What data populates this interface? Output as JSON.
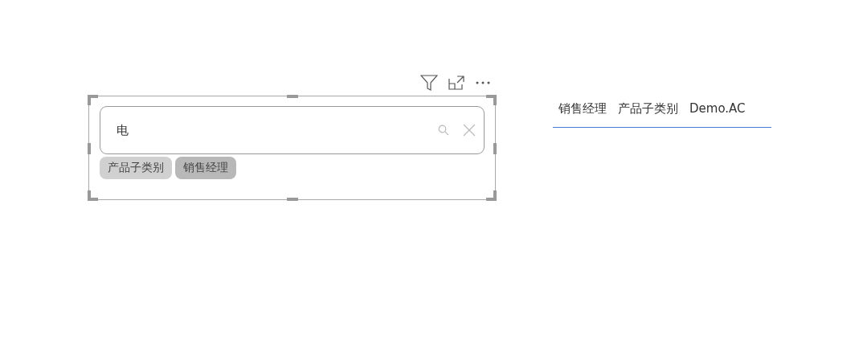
{
  "search": {
    "value": "电"
  },
  "chips": [
    {
      "label": "产品子类别",
      "selected": false
    },
    {
      "label": "销售经理",
      "selected": true
    }
  ],
  "table": {
    "columns": [
      "销售经理",
      "产品子类别",
      "Demo.AC"
    ]
  }
}
